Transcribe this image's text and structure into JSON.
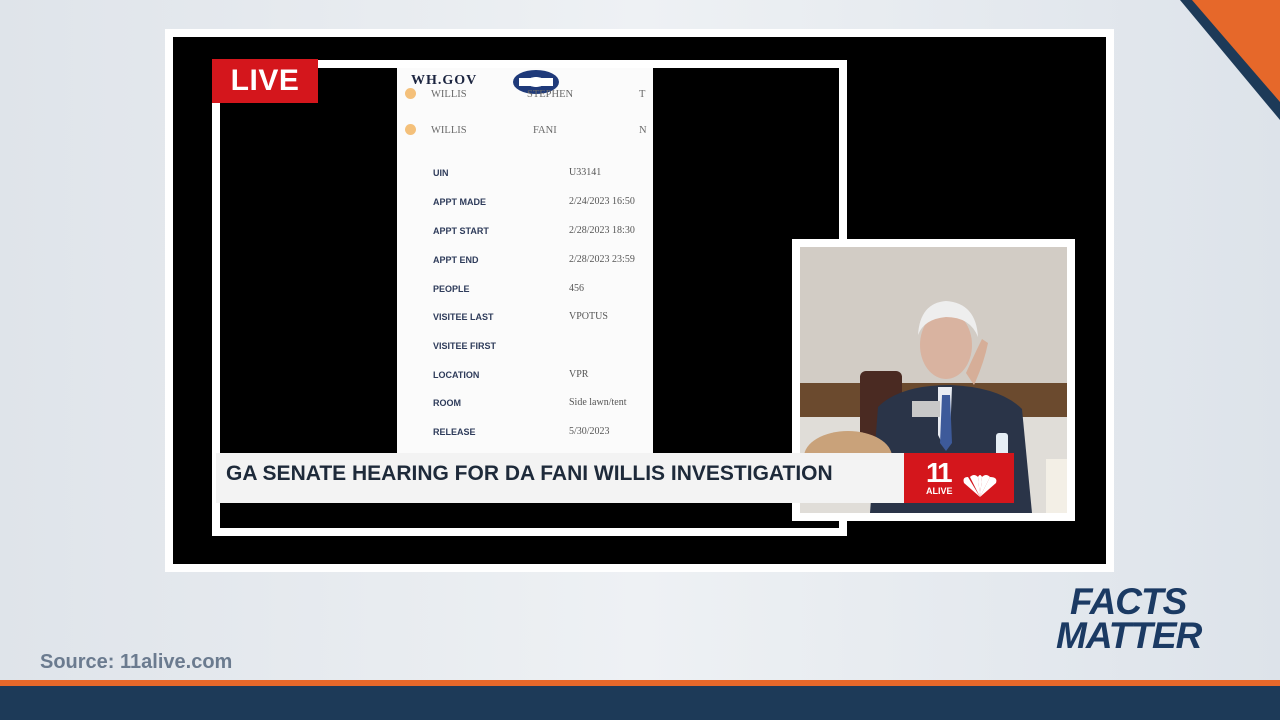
{
  "live_badge": "LIVE",
  "document": {
    "site": "WH.GOV",
    "row1": {
      "last": "WILLIS",
      "first": "STEPHEN",
      "mid": "T"
    },
    "row2": {
      "last": "WILLIS",
      "first": "FANI",
      "mid": "N"
    },
    "fields": [
      {
        "label": "UIN",
        "value": "U33141"
      },
      {
        "label": "APPT MADE",
        "value": "2/24/2023 16:50"
      },
      {
        "label": "APPT START",
        "value": "2/28/2023 18:30"
      },
      {
        "label": "APPT END",
        "value": "2/28/2023 23:59"
      },
      {
        "label": "PEOPLE",
        "value": "456"
      },
      {
        "label": "VISITEE LAST",
        "value": "VPOTUS"
      },
      {
        "label": "VISITEE FIRST",
        "value": ""
      },
      {
        "label": "LOCATION",
        "value": "VPR"
      },
      {
        "label": "ROOM",
        "value": "Side lawn/tent"
      },
      {
        "label": "RELEASE",
        "value": "5/30/2023"
      }
    ]
  },
  "ticker": {
    "headline": "GA SENATE HEARING FOR DA FANI WILLIS INVESTIGATION"
  },
  "station": {
    "number": "11",
    "name": "ALIVE"
  },
  "source": "Source: 11alive.com",
  "show_logo": {
    "line1": "FACTS",
    "line2": "MATTER"
  },
  "colors": {
    "live_red": "#d4161c",
    "navy": "#1d3a58",
    "orange": "#e6682a"
  }
}
